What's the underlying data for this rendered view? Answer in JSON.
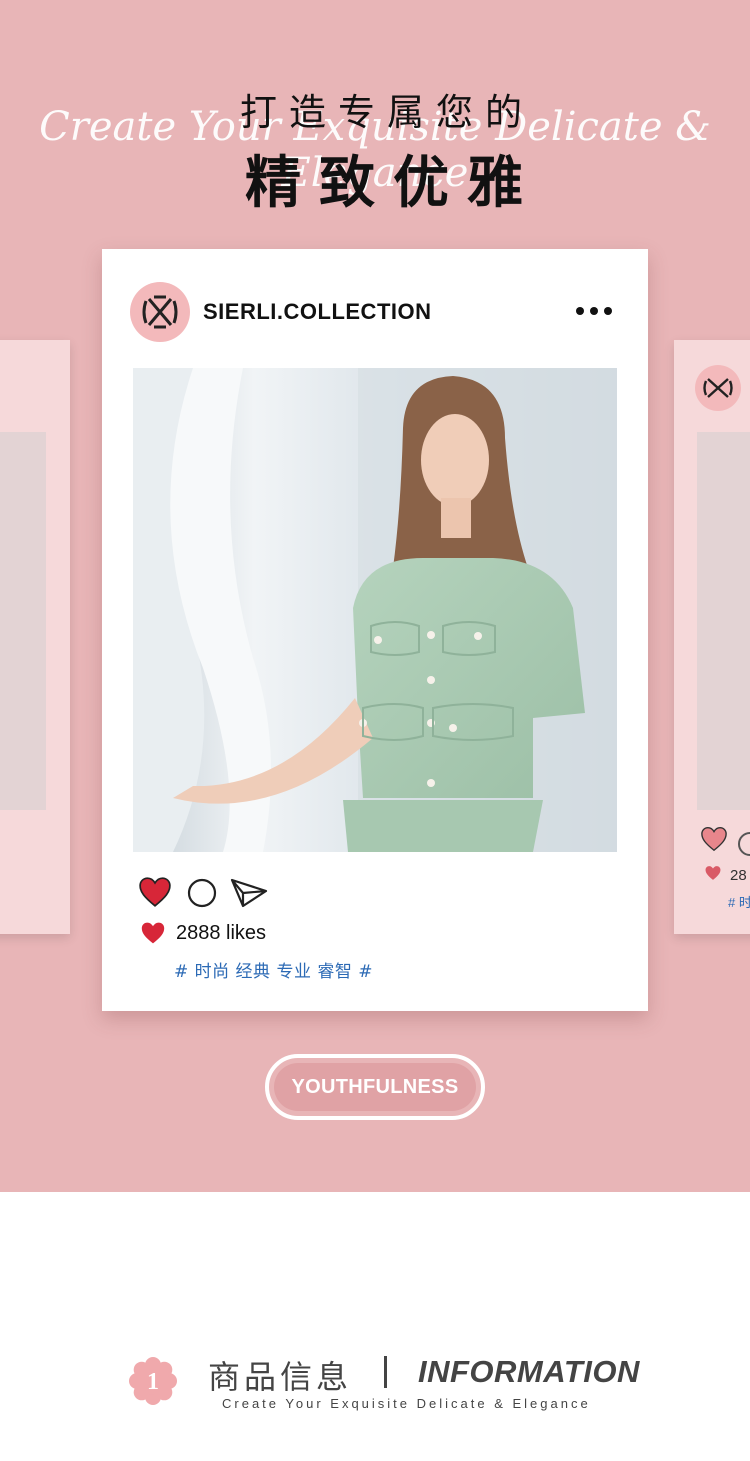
{
  "hero": {
    "title_line1": "打造专属您的",
    "title_line2": "精致优雅",
    "script_text": "Create Your Exquisite Delicate & Elegance",
    "background_color": "#e8b5b7"
  },
  "post": {
    "handle": "SIERLI.COLLECTION",
    "more_icon": "ellipsis-icon",
    "actions": [
      "heart-icon",
      "comment-icon",
      "send-icon"
    ],
    "likes": "2888 likes",
    "tags": "# 时尚 经典 专业 睿智 #",
    "heart_color": "#d72638",
    "tag_color": "#2c6ab5"
  },
  "side_card_right": {
    "likes_partial": "28",
    "tags_partial": "# 时"
  },
  "badge": {
    "label": "YOUTHFULNESS"
  },
  "section": {
    "number": "1",
    "title_cn": "商品信息",
    "title_en": "INFORMATION",
    "subtitle": "Create Your Exquisite Delicate & Elegance"
  }
}
